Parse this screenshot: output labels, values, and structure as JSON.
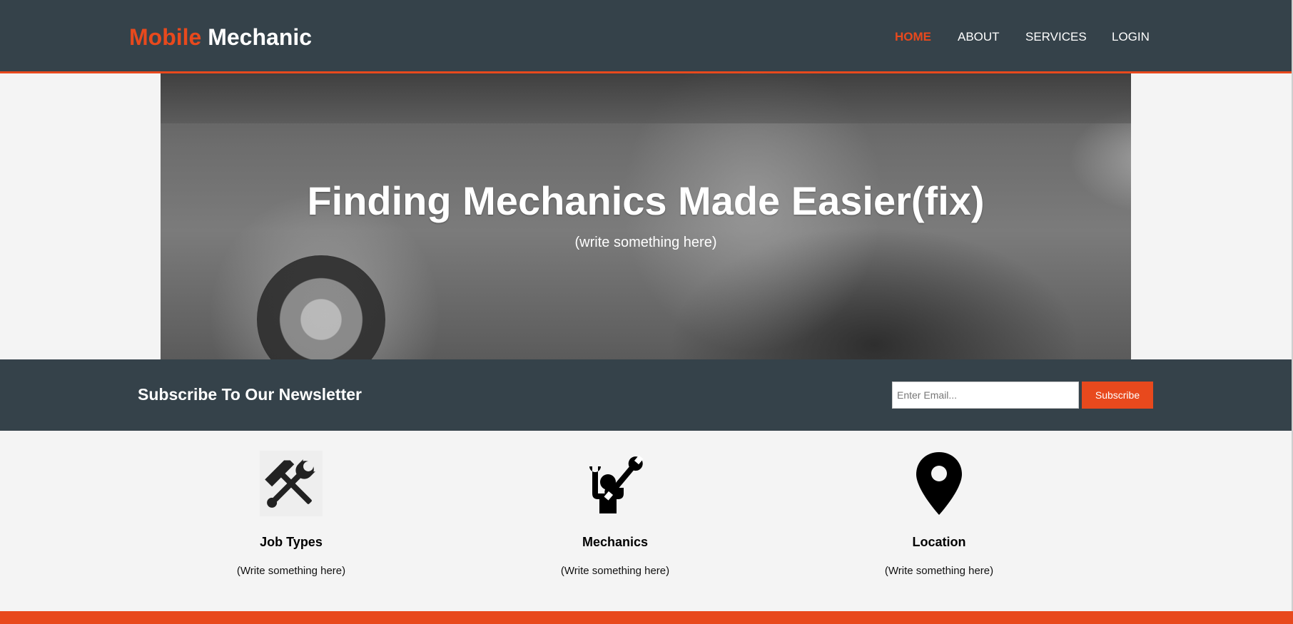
{
  "header": {
    "logo_accent": "Mobile",
    "logo_rest": "Mechanic",
    "nav": [
      {
        "label": "HOME",
        "active": true
      },
      {
        "label": "ABOUT",
        "active": false
      },
      {
        "label": "SERVICES",
        "active": false
      },
      {
        "label": "LOGIN",
        "active": false
      }
    ]
  },
  "showcase": {
    "title": "Finding Mechanics Made Easier(fix)",
    "subtitle": "(write something here)"
  },
  "newsletter": {
    "heading": "Subscribe To Our Newsletter",
    "email_placeholder": "Enter Email...",
    "subscribe_label": "Subscribe"
  },
  "boxes": [
    {
      "icon": "hammer-wrench-icon",
      "title": "Job Types",
      "text": "(Write something here)"
    },
    {
      "icon": "mechanic-icon",
      "title": "Mechanics",
      "text": "(Write something here)"
    },
    {
      "icon": "map-pin-icon",
      "title": "Location",
      "text": "(Write something here)"
    }
  ],
  "colors": {
    "header_bg": "#35424a",
    "accent": "#e8491d",
    "page_bg": "#f4f4f4"
  }
}
